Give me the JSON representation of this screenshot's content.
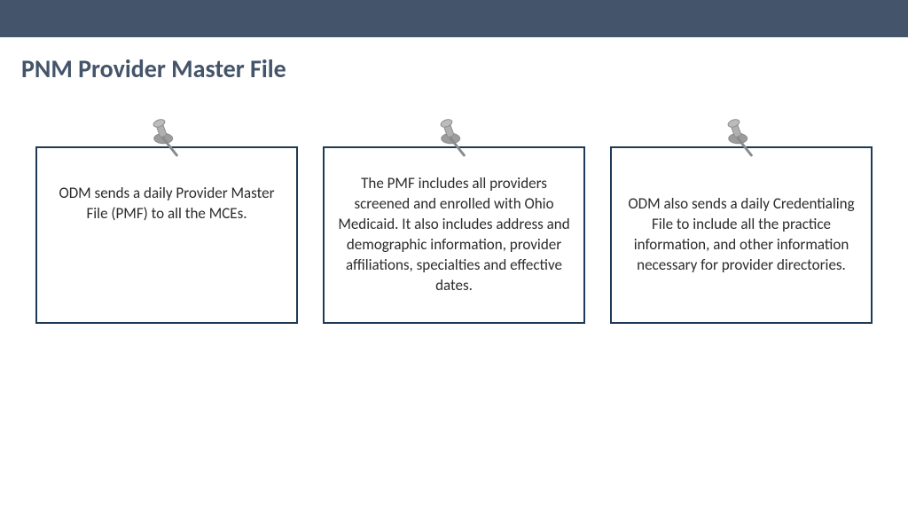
{
  "title": "PNM Provider Master File",
  "cards": [
    {
      "text": "ODM sends a daily Provider Master File (PMF) to all the MCEs."
    },
    {
      "text": "The PMF includes all providers screened and enrolled with Ohio Medicaid.  It also includes address and demographic information, provider affiliations, specialties and effective dates."
    },
    {
      "text": "ODM also sends a daily Credentialing File to include all the practice information, and other information necessary for provider directories."
    }
  ]
}
